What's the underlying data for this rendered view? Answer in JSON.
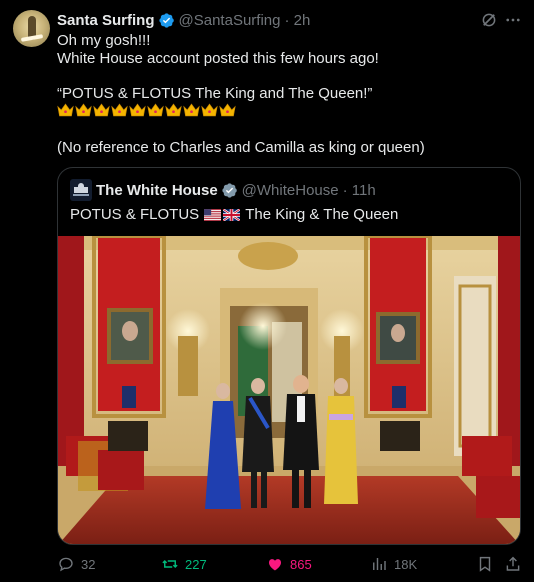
{
  "post": {
    "author_name": "Santa Surfing",
    "author_handle": "@SantaSurfing",
    "time": "· 2h",
    "lines": [
      "Oh my gosh!!!",
      "White House account posted this few hours ago!",
      "",
      "“POTUS & FLOTUS The King and The Queen!”",
      "",
      "",
      "(No reference to Charles and Camilla as king or queen)"
    ],
    "crown_count": 10
  },
  "quote": {
    "author_name": "The White House",
    "author_handle": "@WhiteHouse",
    "time": "· 11h",
    "text_prefix": "POTUS & FLOTUS",
    "text_suffix": "The King & The Queen",
    "flags": [
      "us-flag",
      "uk-flag"
    ]
  },
  "actions": {
    "replies": "32",
    "reposts": "227",
    "likes": "865",
    "views": "18K"
  },
  "colors": {
    "background": "#000000",
    "text": "#e7e9ea",
    "muted": "#71767b",
    "verified_blue": "#1d9bf0",
    "verified_gray": "#829aab",
    "repost_green": "#00ba7c",
    "like_pink": "#f91880",
    "border": "#2f3336"
  },
  "icons": [
    "verified-badge-icon",
    "grok-icon",
    "more-icon",
    "crown-icon",
    "reply-icon",
    "repost-icon",
    "like-icon",
    "views-icon",
    "bookmark-icon",
    "share-icon"
  ]
}
